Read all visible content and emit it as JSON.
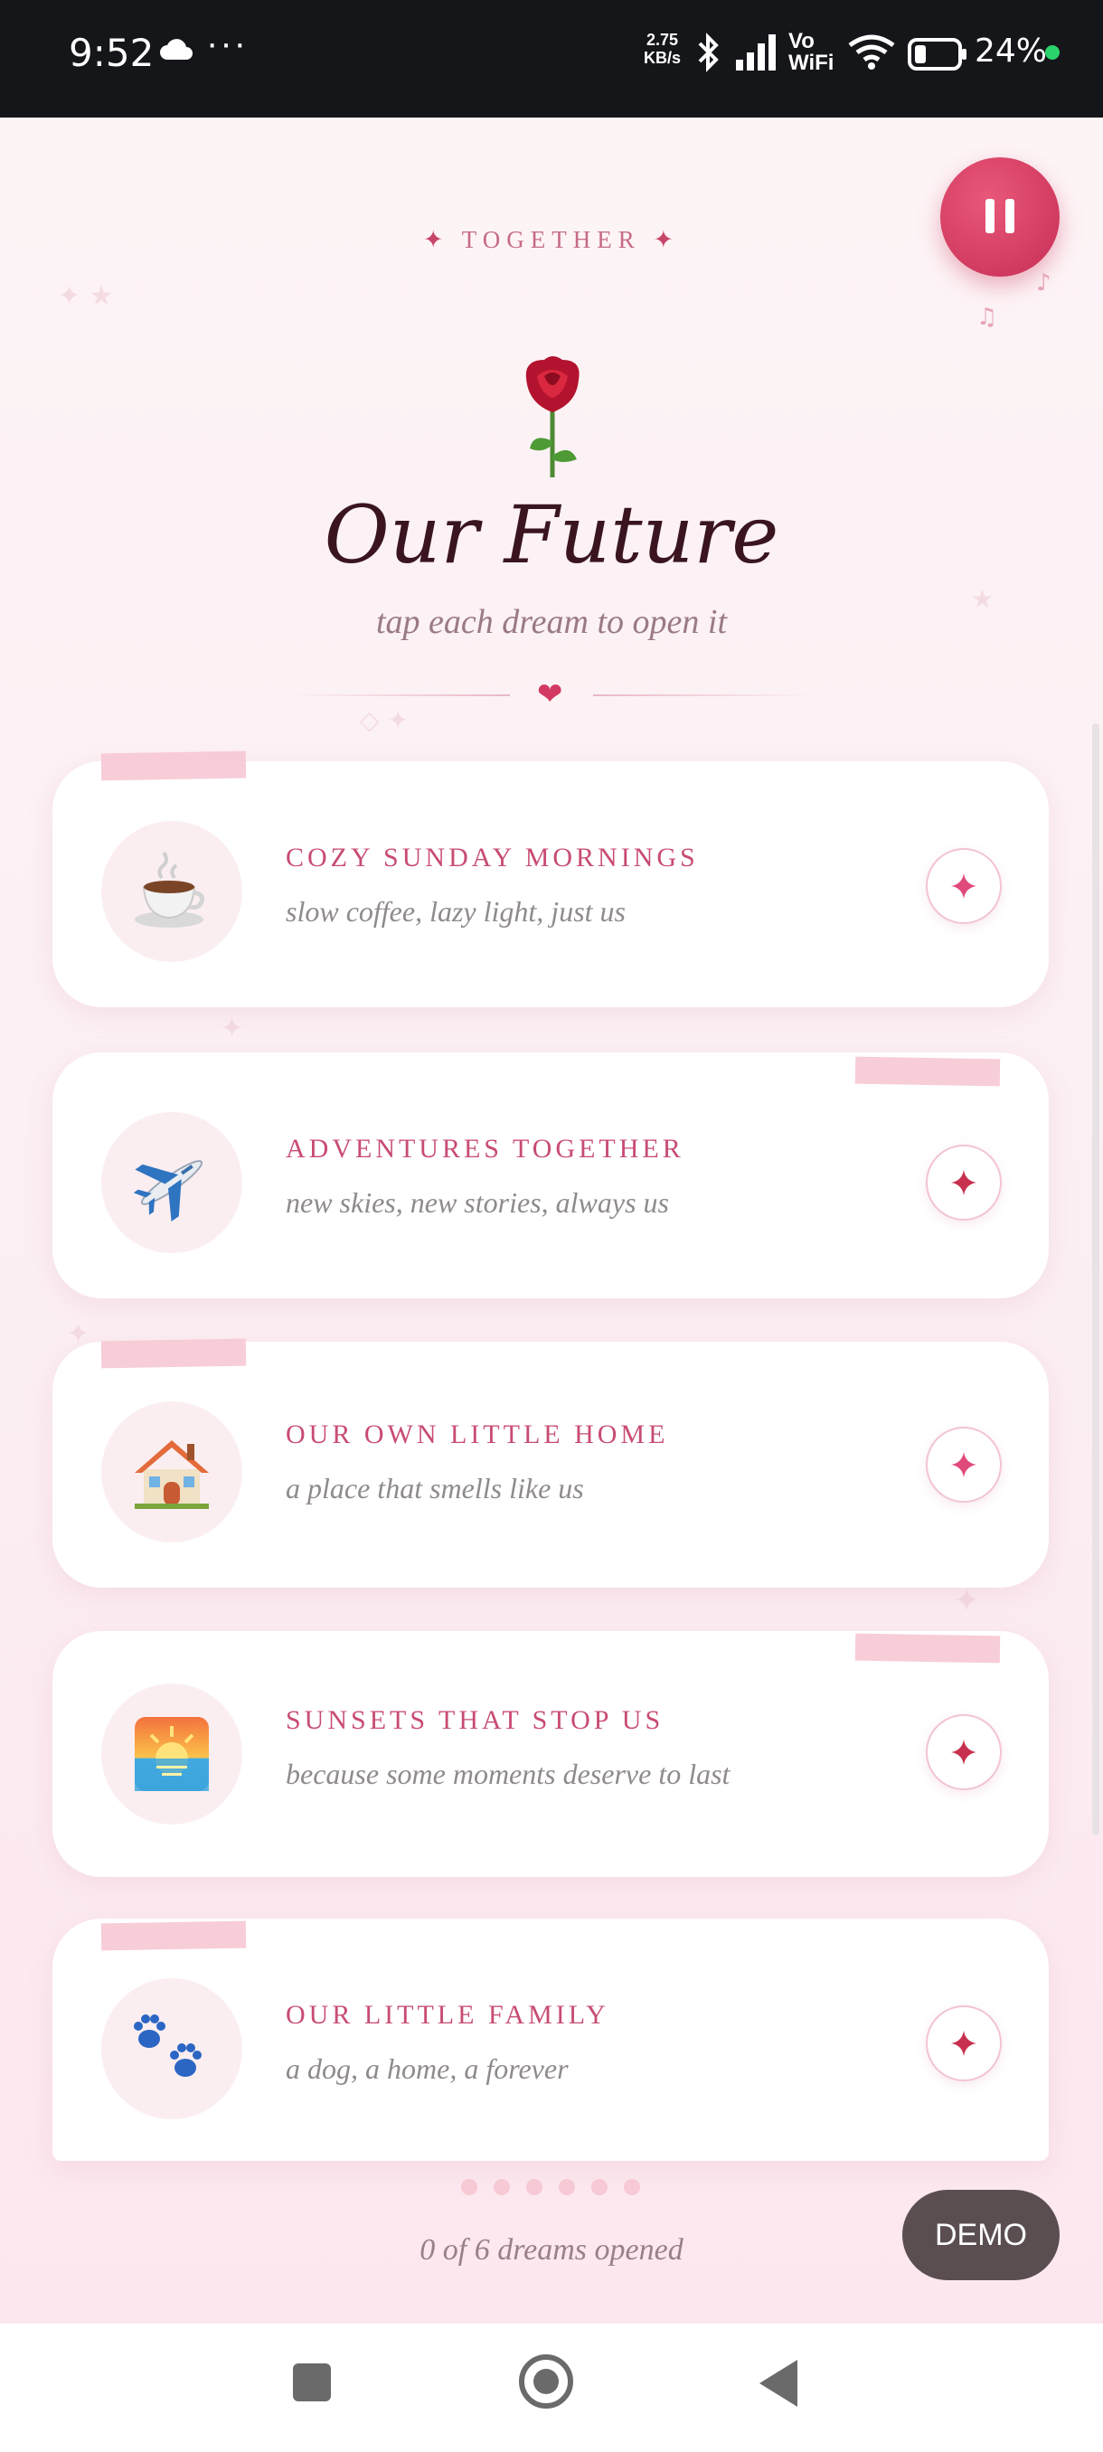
{
  "status_bar": {
    "time": "9:52",
    "dots": "···",
    "speed_value": "2.75",
    "speed_unit": "KB/s",
    "vo": "Vo",
    "wifi_label": "WiFi",
    "battery": "24%"
  },
  "header": {
    "kicker": "TOGETHER",
    "title": "Our Future",
    "subtitle": "tap each dream to open it"
  },
  "dreams": [
    {
      "title": "COZY SUNDAY MORNINGS",
      "subtitle": "slow coffee, lazy light, just us",
      "icon": "coffee-icon"
    },
    {
      "title": "ADVENTURES TOGETHER",
      "subtitle": "new skies, new stories, always us",
      "icon": "airplane-icon"
    },
    {
      "title": "OUR OWN LITTLE HOME",
      "subtitle": "a place that smells like us",
      "icon": "house-icon"
    },
    {
      "title": "SUNSETS THAT STOP US",
      "subtitle": "because some moments deserve to last",
      "icon": "sunset-icon"
    },
    {
      "title": "OUR LITTLE FAMILY",
      "subtitle": "a dog, a home, a forever",
      "icon": "paw-prints-icon"
    }
  ],
  "progress": {
    "text": "0 of 6 dreams opened",
    "opened": 0,
    "total": 6
  },
  "demo_label": "DEMO",
  "colors": {
    "accent": "#c84c72",
    "pause_button": "#d63c63",
    "background": "#fdf1f4"
  }
}
